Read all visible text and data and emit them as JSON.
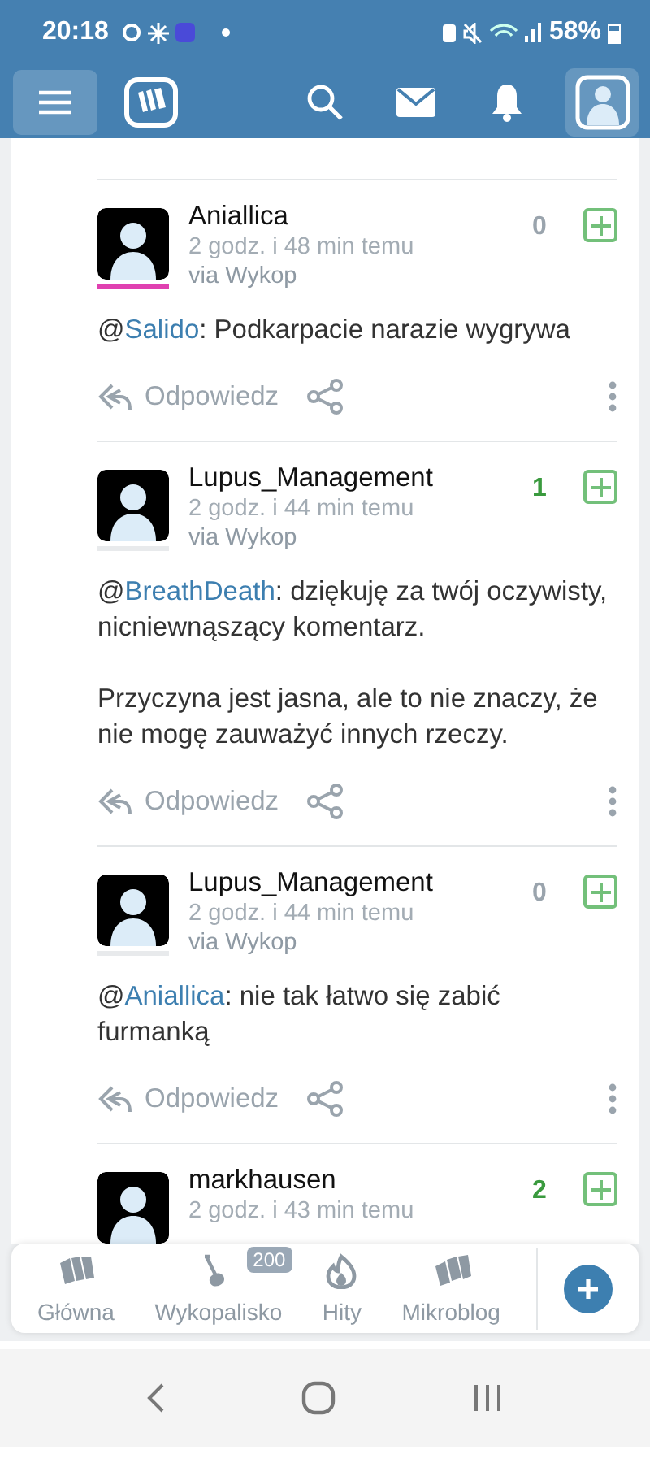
{
  "status_bar": {
    "time": "20:18",
    "battery": "58%"
  },
  "comments": [
    {
      "author": "Aniallica",
      "time": "2 godz. i 48 min temu",
      "via": "via Wykop",
      "score": "0",
      "upvoted": false,
      "female": true,
      "paragraphs": [
        [
          {
            "kind": "plain",
            "text": "@"
          },
          {
            "kind": "mention",
            "text": "Salido"
          },
          {
            "kind": "plain",
            "text": ": Podkarpacie narazie wygrywa"
          }
        ]
      ],
      "reply": "Odpowiedz"
    },
    {
      "author": "Lupus_Management",
      "time": "2 godz. i 44 min temu",
      "via": "via Wykop",
      "score": "1",
      "upvoted": true,
      "female": false,
      "paragraphs": [
        [
          {
            "kind": "plain",
            "text": "@"
          },
          {
            "kind": "mention",
            "text": "BreathDeath"
          },
          {
            "kind": "plain",
            "text": ": dziękuję za twój oczywisty, nicniewnąszący komentarz."
          }
        ],
        [
          {
            "kind": "plain",
            "text": "Przyczyna jest jasna, ale to nie znaczy, że nie mogę zauważyć innych rzeczy."
          }
        ]
      ],
      "reply": "Odpowiedz"
    },
    {
      "author": "Lupus_Management",
      "time": "2 godz. i 44 min temu",
      "via": "via Wykop",
      "score": "0",
      "upvoted": false,
      "female": false,
      "paragraphs": [
        [
          {
            "kind": "plain",
            "text": "@"
          },
          {
            "kind": "mention",
            "text": "Aniallica"
          },
          {
            "kind": "plain",
            "text": ": nie tak łatwo się zabić furmanką"
          }
        ]
      ],
      "reply": "Odpowiedz"
    },
    {
      "author": "markhausen",
      "time": "2 godz. i 43 min temu",
      "score": "2",
      "upvoted": true
    }
  ],
  "bottom_nav": [
    {
      "label": "Główna"
    },
    {
      "label": "Wykopalisko",
      "badge": "200"
    },
    {
      "label": "Hity"
    },
    {
      "label": "Mikroblog"
    }
  ]
}
